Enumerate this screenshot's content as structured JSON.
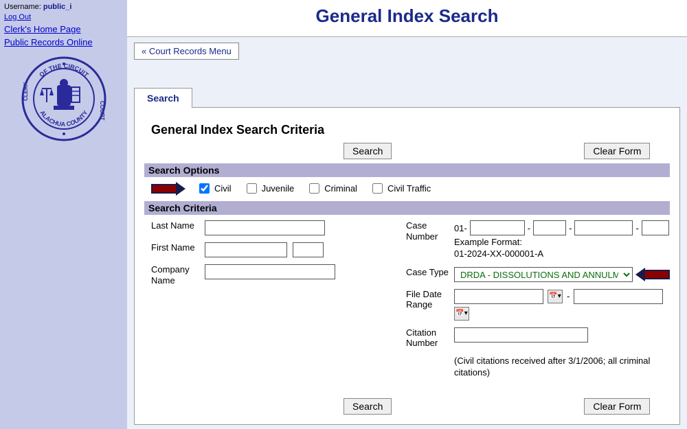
{
  "sidebar": {
    "username_label": "Username:",
    "username": "public_i",
    "logout": "Log Out",
    "link_home": "Clerk's Home Page",
    "link_records": "Public Records Online",
    "seal_top": "OF THE CIRCUIT",
    "seal_left": "CLERK",
    "seal_right": "COURT",
    "seal_bottom": "ALACHUA COUNTY"
  },
  "page_title": "General Index Search",
  "menu_button": "« Court Records Menu",
  "tabs": {
    "search": "Search"
  },
  "panel": {
    "heading": "General Index Search Criteria",
    "search_btn": "Search",
    "clear_btn": "Clear Form",
    "section_options": "Search Options",
    "section_criteria": "Search Criteria",
    "opts": {
      "civil": {
        "label": "Civil",
        "checked": true
      },
      "juvenile": {
        "label": "Juvenile",
        "checked": false
      },
      "criminal": {
        "label": "Criminal",
        "checked": false
      },
      "civil_traffic": {
        "label": "Civil Traffic",
        "checked": false
      }
    },
    "fields": {
      "last_name": "Last Name",
      "first_name": "First Name",
      "company_name": "Company Name",
      "case_number": "Case Number",
      "case_num_prefix": "01-",
      "example_label": "Example Format:",
      "example_value": "01-2024-XX-000001-A",
      "case_type": "Case Type",
      "case_type_value": "DRDA - DISSOLUTIONS AND ANNULMENTS",
      "file_date_range": "File Date Range",
      "date_sep": "-",
      "citation_number": "Citation Number",
      "citation_note": "(Civil citations received after 3/1/2006; all criminal citations)"
    }
  }
}
